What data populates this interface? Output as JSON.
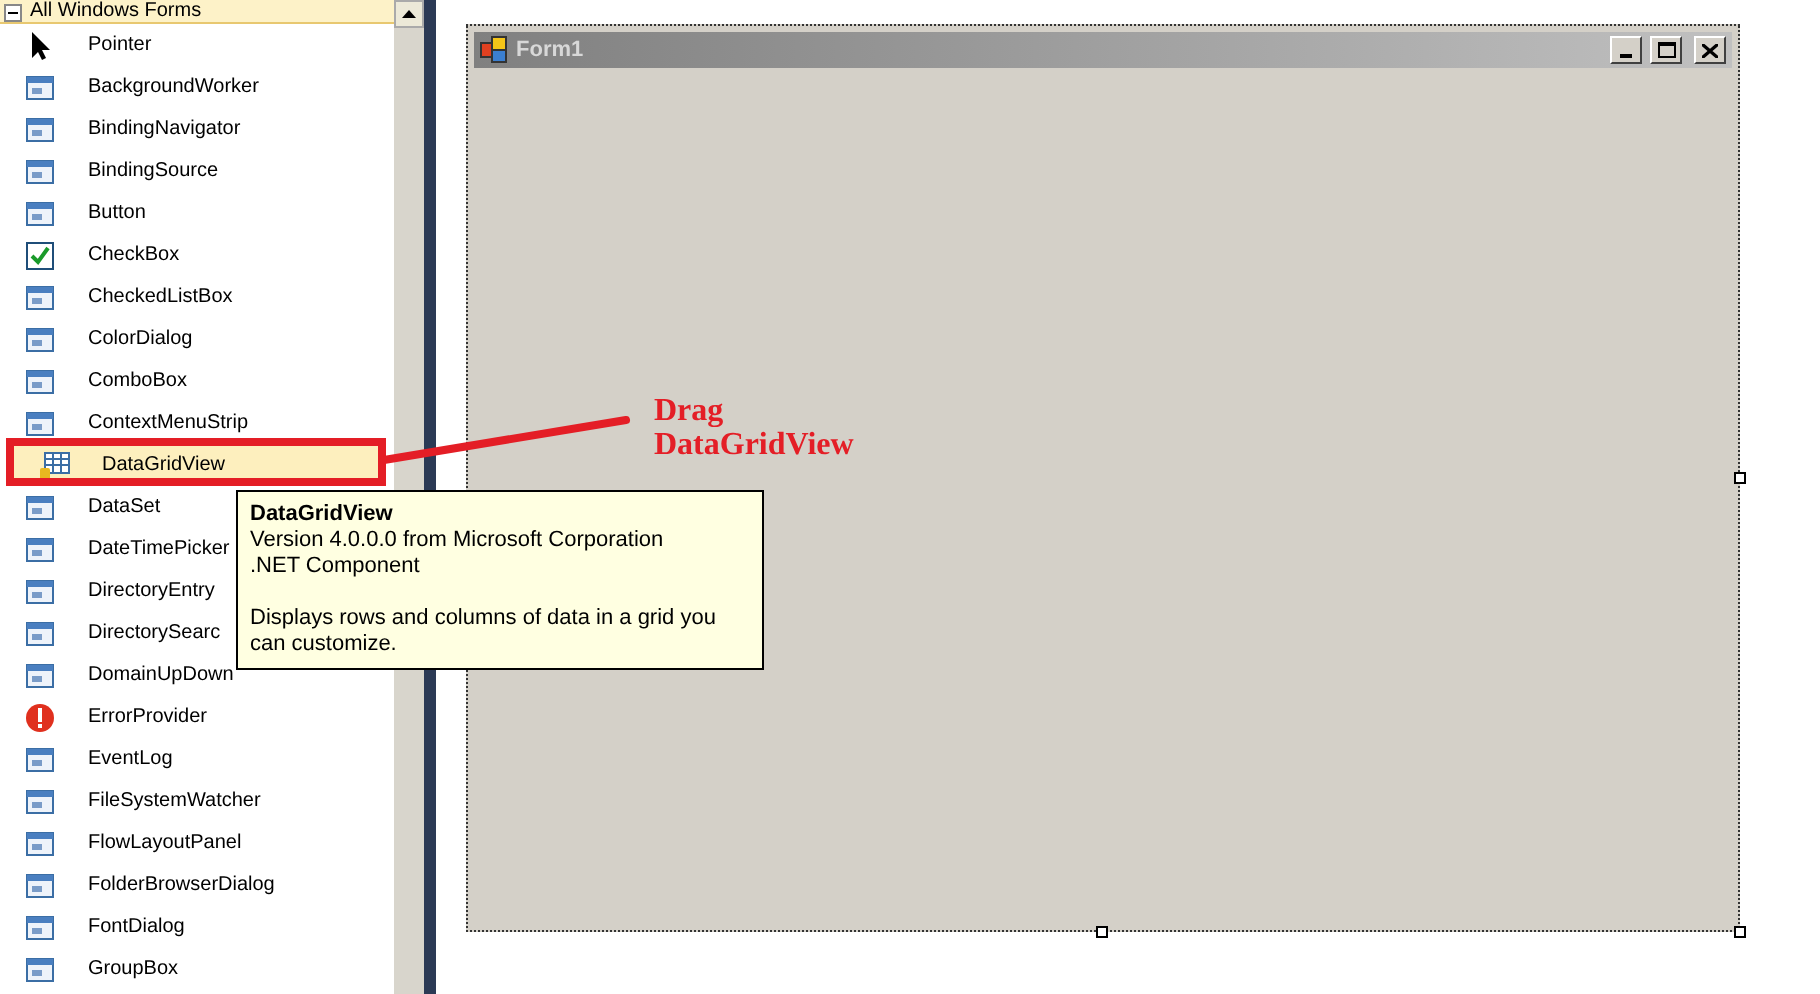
{
  "toolbox": {
    "group": "All Windows Forms",
    "expanded": true,
    "items": [
      {
        "label": "Pointer",
        "selected": false
      },
      {
        "label": "BackgroundWorker",
        "selected": false
      },
      {
        "label": "BindingNavigator",
        "selected": false
      },
      {
        "label": "BindingSource",
        "selected": false
      },
      {
        "label": "Button",
        "selected": false
      },
      {
        "label": "CheckBox",
        "selected": false
      },
      {
        "label": "CheckedListBox",
        "selected": false
      },
      {
        "label": "ColorDialog",
        "selected": false
      },
      {
        "label": "ComboBox",
        "selected": false
      },
      {
        "label": "ContextMenuStrip",
        "selected": false
      },
      {
        "label": "DataGridView",
        "selected": true
      },
      {
        "label": "DataSet",
        "selected": false
      },
      {
        "label": "DateTimePicker",
        "selected": false
      },
      {
        "label": "DirectoryEntry",
        "selected": false
      },
      {
        "label": "DirectorySearc",
        "selected": false
      },
      {
        "label": "DomainUpDown",
        "selected": false
      },
      {
        "label": "ErrorProvider",
        "selected": false
      },
      {
        "label": "EventLog",
        "selected": false
      },
      {
        "label": "FileSystemWatcher",
        "selected": false
      },
      {
        "label": "FlowLayoutPanel",
        "selected": false
      },
      {
        "label": "FolderBrowserDialog",
        "selected": false
      },
      {
        "label": "FontDialog",
        "selected": false
      },
      {
        "label": "GroupBox",
        "selected": false
      }
    ]
  },
  "tooltip": {
    "title": "DataGridView",
    "version": "Version 4.0.0.0 from Microsoft Corporation",
    "type": ".NET Component",
    "description": "Displays rows and columns of data in a grid you can customize."
  },
  "annotation": {
    "lines": [
      "Drag",
      "DataGridView"
    ]
  },
  "form": {
    "title": "Form1"
  }
}
